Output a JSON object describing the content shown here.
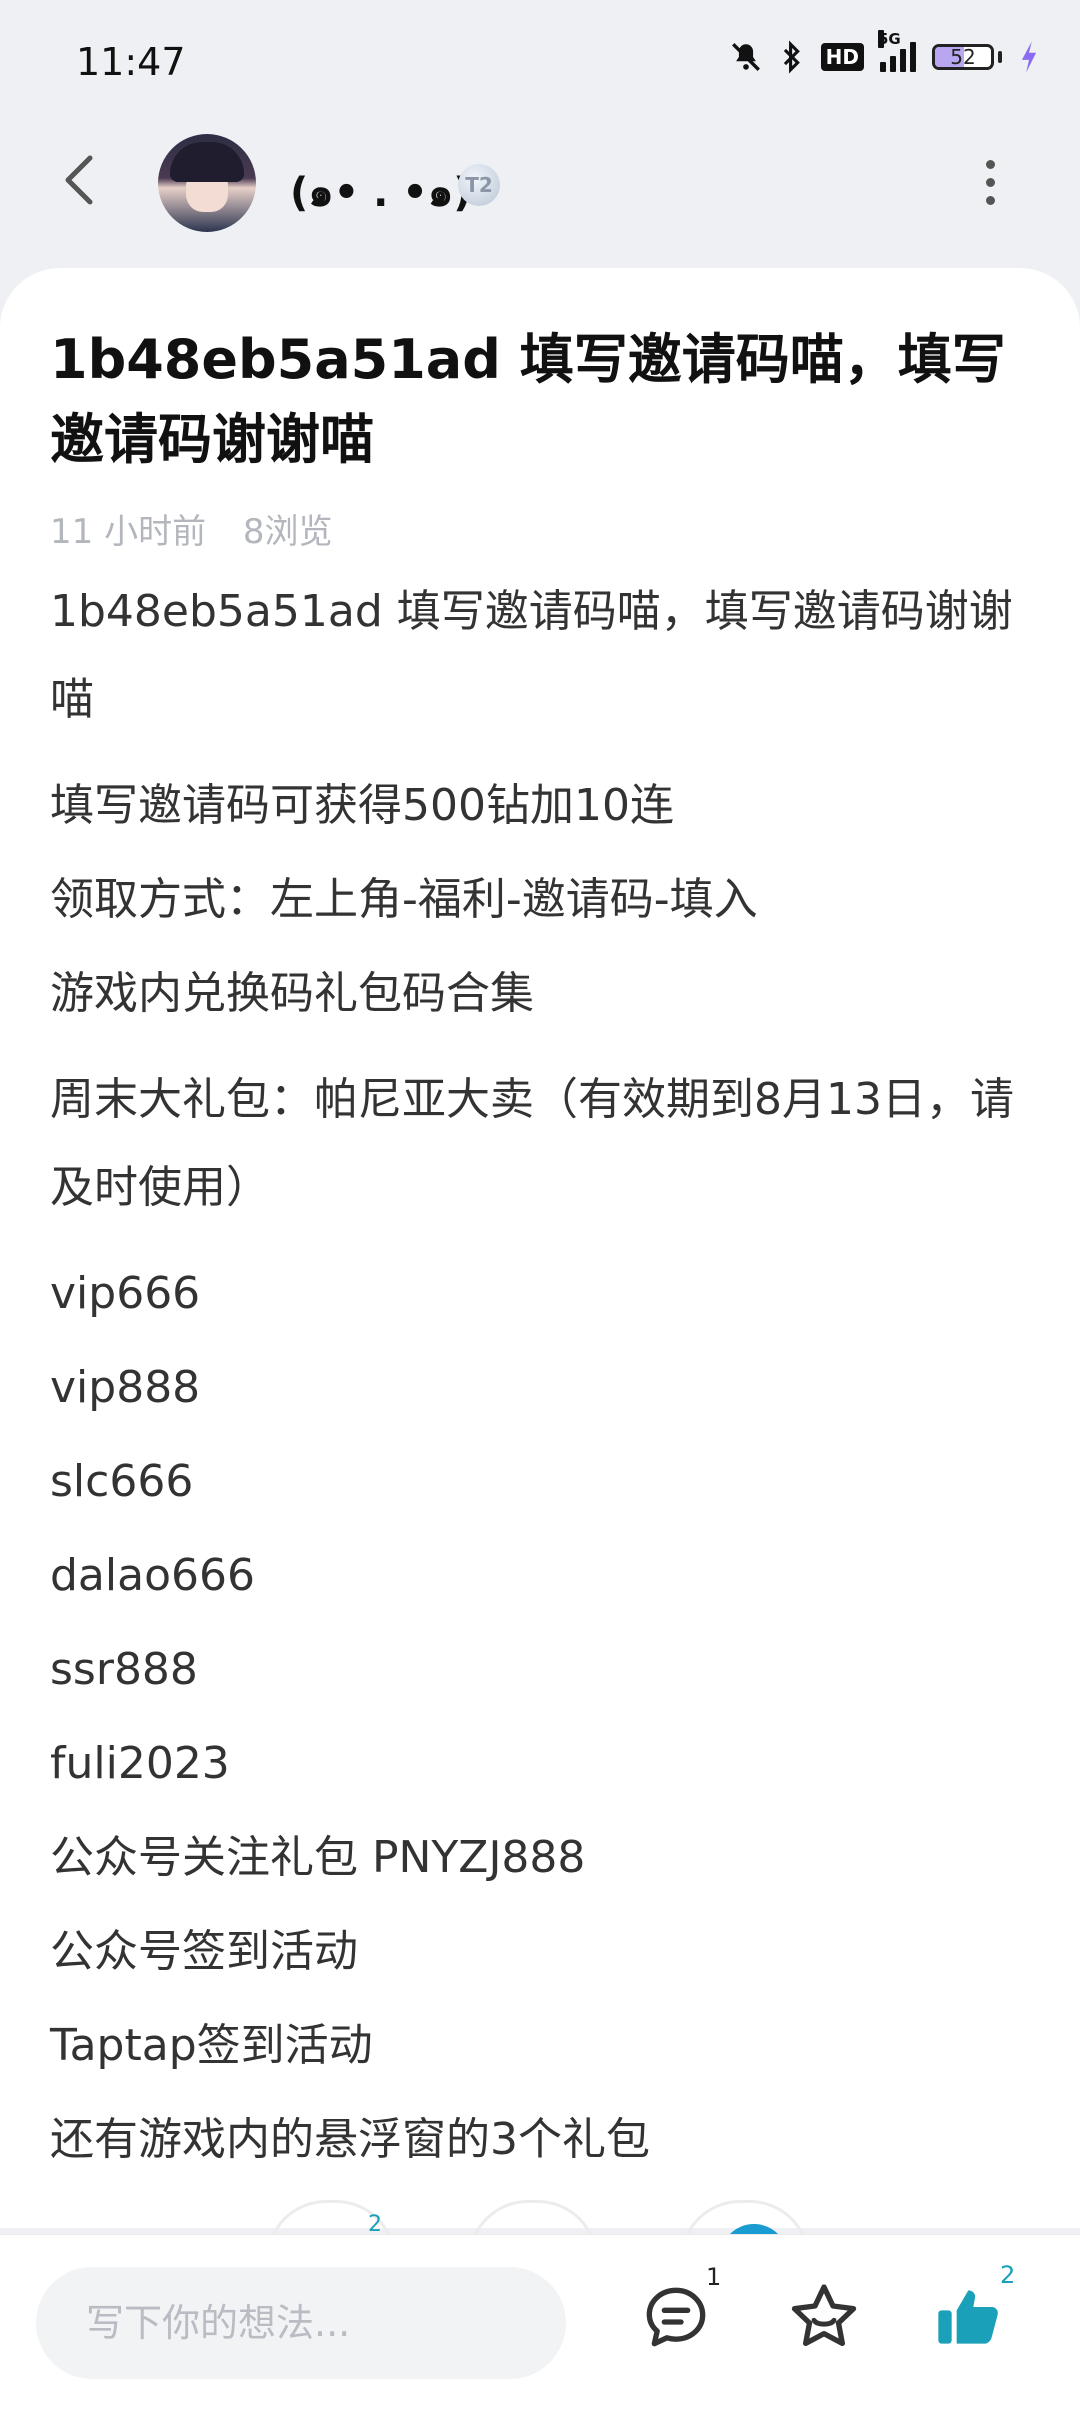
{
  "status_bar": {
    "time": "11:47",
    "network_tag": "5G",
    "hd_label": "HD",
    "battery_level": "52",
    "battery_fraction": 0.52
  },
  "header": {
    "username": "(๑• . •๑)",
    "badge": "T2",
    "back_icon": "back-arrow-icon",
    "more_icon": "more-vertical-icon"
  },
  "post": {
    "title": "1b48eb5a51ad 填写邀请码喵，填写邀请码谢谢喵",
    "time_ago": "11 小时前",
    "views": "8浏览",
    "paragraphs": [
      "1b48eb5a51ad 填写邀请码喵，填写邀请码谢谢喵",
      "填写邀请码可获得500钻加10连",
      "领取方式：左上角-福利-邀请码-填入",
      "游戏内兑换码礼包码合集",
      "周末大礼包：帕尼亚大卖（有效期到8月13日，请及时使用）",
      "vip666",
      "vip888",
      "slc666",
      "dalao666",
      "ssr888",
      "fuli2023",
      "公众号关注礼包 PNYZJ888",
      "公众号签到活动",
      "Taptap签到活动",
      "还有游戏内的悬浮窗的3个礼包"
    ]
  },
  "reactions": {
    "first_count": "2"
  },
  "bottom_bar": {
    "comment_placeholder": "写下你的想法...",
    "comment_count": "1",
    "like_count": "2",
    "accent_color": "#1aa0b8"
  }
}
